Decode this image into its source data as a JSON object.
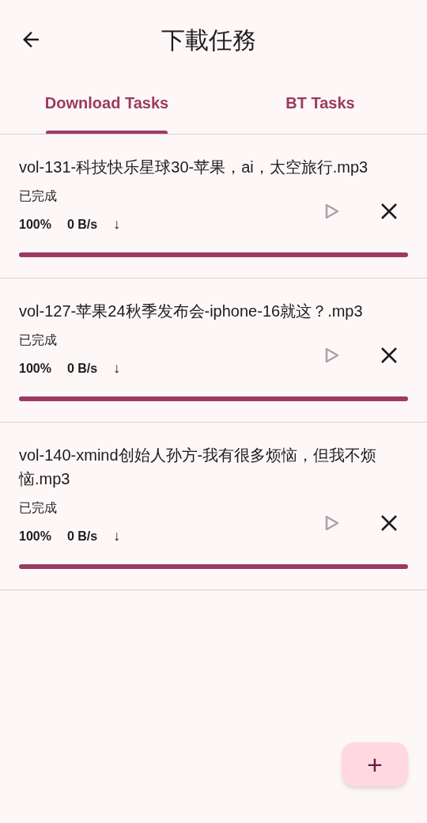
{
  "app_bar": {
    "title": "下載任務"
  },
  "tabs": [
    {
      "label": "Download Tasks",
      "selected": true
    },
    {
      "label": "BT Tasks",
      "selected": false
    }
  ],
  "tasks": [
    {
      "name": "vol-131-科技快乐星球30-苹果，ai，太空旅行.mp3",
      "status": "已完成",
      "percent": "100%",
      "speed": "0 B/s",
      "arrow": "↓",
      "play_disabled": true,
      "level": 1
    },
    {
      "name": "vol-127-苹果24秋季发布会-iphone-16就这？.mp3",
      "status": "已完成",
      "percent": "100%",
      "speed": "0 B/s",
      "arrow": "↓",
      "play_disabled": true,
      "level": 1
    },
    {
      "name": "vol-140-xmind创始人孙方-我有很多烦恼，但我不烦恼.mp3",
      "status": "已完成",
      "percent": "100%",
      "speed": "0 B/s",
      "arrow": "↓",
      "play_disabled": true,
      "level": 1
    }
  ],
  "fab": {
    "label": "+"
  }
}
